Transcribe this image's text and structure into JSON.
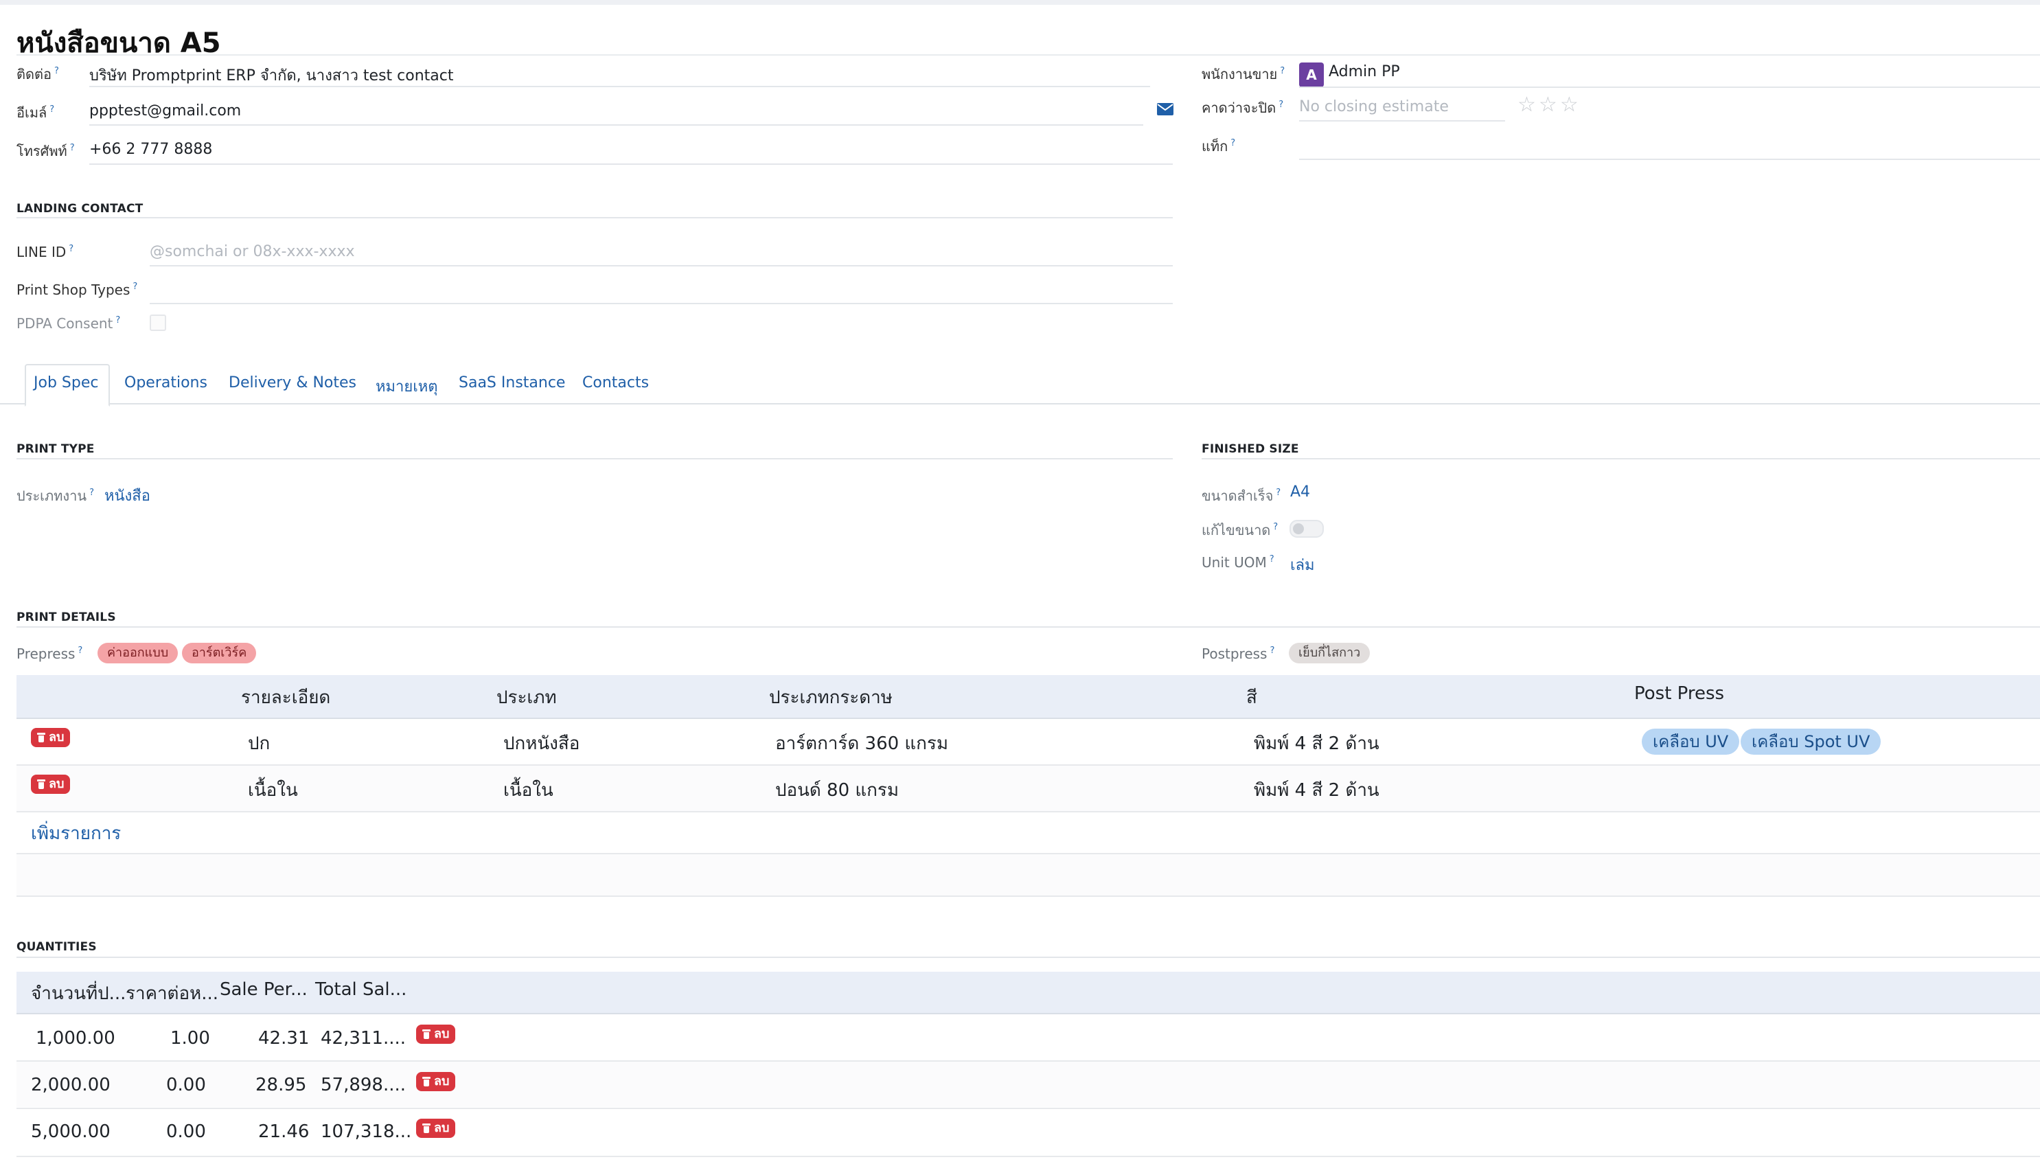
{
  "record": {
    "title": "หนังสือขนาด A5"
  },
  "contact": {
    "partner_label": "ติดต่อ",
    "partner_value": "บริษัท Promptprint ERP จำกัด, นางสาว test contact",
    "email_label": "อีเมล์",
    "email_value": "ppptest@gmail.com",
    "phone_label": "โทรศัพท์",
    "phone_value": "+66 2 777 8888"
  },
  "sales": {
    "salesperson_label": "พนักงานขาย",
    "salesperson_initial": "A",
    "salesperson_value": "Admin PP",
    "closing_label": "คาดว่าจะปิด",
    "closing_placeholder": "No closing estimate",
    "tags_label": "แท็ก",
    "priority_stars": 0
  },
  "landing_contact": {
    "section_title": "LANDING CONTACT",
    "line_id_label": "LINE ID",
    "line_id_placeholder": "@somchai or 08x-xxx-xxxx",
    "shop_types_label": "Print Shop Types",
    "pdpa_label": "PDPA Consent"
  },
  "tabs": [
    {
      "label": "Job Spec",
      "active": true
    },
    {
      "label": "Operations"
    },
    {
      "label": "Delivery & Notes"
    },
    {
      "label": "หมายเหตุ"
    },
    {
      "label": "SaaS Instance"
    },
    {
      "label": "Contacts"
    }
  ],
  "print_type": {
    "section_title": "PRINT TYPE",
    "job_type_label": "ประเภทงาน",
    "job_type_value": "หนังสือ"
  },
  "finished_size": {
    "section_title": "FINISHED SIZE",
    "size_label": "ขนาดสำเร็จ",
    "size_value": "A4",
    "edit_size_label": "แก้ไขขนาด",
    "edit_size_on": false,
    "uom_label": "Unit UOM",
    "uom_value": "เล่ม"
  },
  "print_details": {
    "section_title": "PRINT DETAILS",
    "prepress_label": "Prepress",
    "prepress_tags": [
      "ค่าออกแบบ",
      "อาร์ตเวิร์ค"
    ],
    "postpress_label": "Postpress",
    "postpress_tags": [
      "เย็บกี่ไสกาว"
    ],
    "columns": [
      "รายละเอียด",
      "ประเภท",
      "ประเภทกระดาษ",
      "สี",
      "Post Press"
    ],
    "delete_label": "ลบ",
    "rows": [
      {
        "detail": "ปก",
        "type": "ปกหนังสือ",
        "paper": "อาร์ตการ์ด 360 แกรม",
        "color": "พิมพ์ 4 สี 2 ด้าน",
        "post_press": [
          "เคลือบ UV",
          "เคลือบ Spot UV"
        ]
      },
      {
        "detail": "เนื้อใน",
        "type": "เนื้อใน",
        "paper": "ปอนด์ 80 แกรม",
        "color": "พิมพ์ 4 สี 2 ด้าน",
        "post_press": []
      }
    ],
    "add_line_label": "เพิ่มรายการ"
  },
  "quantities": {
    "section_title": "QUANTITIES",
    "columns": [
      "จำนวนที่ป...",
      "ราคาต่อห...",
      "Sale Per...",
      "Total Sal..."
    ],
    "delete_label": "ลบ",
    "rows": [
      {
        "qty": "1,000.00",
        "unit_cost": "1.00",
        "sale_per": "42.31",
        "total": "42,311...."
      },
      {
        "qty": "2,000.00",
        "unit_cost": "0.00",
        "sale_per": "28.95",
        "total": "57,898...."
      },
      {
        "qty": "5,000.00",
        "unit_cost": "0.00",
        "sale_per": "21.46",
        "total": "107,318..."
      }
    ]
  },
  "icons": {
    "email_action": "envelope-icon",
    "delete": "trash-icon",
    "help": "question-mark"
  },
  "colors": {
    "link": "#1f5fa8",
    "avatar": "#6b3fa0",
    "delete_badge": "#d9363e",
    "prepress_tag": "#f4a3a6",
    "postpress_tag": "#e2dedd",
    "post_press_pill": "#b8d6f4",
    "table_header": "#e9eef7"
  }
}
